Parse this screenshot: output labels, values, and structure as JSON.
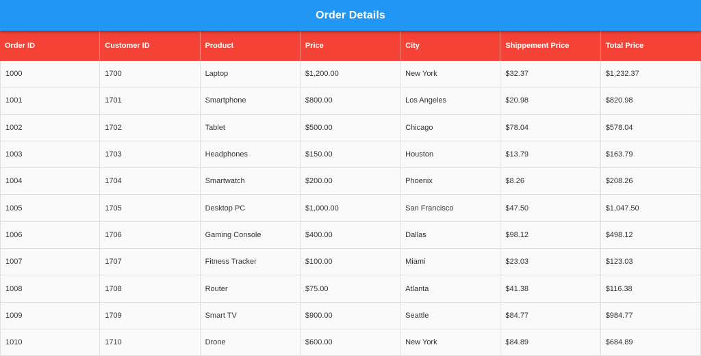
{
  "appbar": {
    "title": "Order Details"
  },
  "colors": {
    "appbar": "#2196f3",
    "header": "#f44336"
  },
  "table": {
    "columns": [
      "Order ID",
      "Customer ID",
      "Product",
      "Price",
      "City",
      "Shippement Price",
      "Total Price"
    ],
    "rows": [
      [
        "1000",
        "1700",
        "Laptop",
        "$1,200.00",
        "New York",
        "$32.37",
        "$1,232.37"
      ],
      [
        "1001",
        "1701",
        "Smartphone",
        "$800.00",
        "Los Angeles",
        "$20.98",
        "$820.98"
      ],
      [
        "1002",
        "1702",
        "Tablet",
        "$500.00",
        "Chicago",
        "$78.04",
        "$578.04"
      ],
      [
        "1003",
        "1703",
        "Headphones",
        "$150.00",
        "Houston",
        "$13.79",
        "$163.79"
      ],
      [
        "1004",
        "1704",
        "Smartwatch",
        "$200.00",
        "Phoenix",
        "$8.26",
        "$208.26"
      ],
      [
        "1005",
        "1705",
        "Desktop PC",
        "$1,000.00",
        "San Francisco",
        "$47.50",
        "$1,047.50"
      ],
      [
        "1006",
        "1706",
        "Gaming Console",
        "$400.00",
        "Dallas",
        "$98.12",
        "$498.12"
      ],
      [
        "1007",
        "1707",
        "Fitness Tracker",
        "$100.00",
        "Miami",
        "$23.03",
        "$123.03"
      ],
      [
        "1008",
        "1708",
        "Router",
        "$75.00",
        "Atlanta",
        "$41.38",
        "$116.38"
      ],
      [
        "1009",
        "1709",
        "Smart TV",
        "$900.00",
        "Seattle",
        "$84.77",
        "$984.77"
      ],
      [
        "1010",
        "1710",
        "Drone",
        "$600.00",
        "New York",
        "$84.89",
        "$684.89"
      ]
    ]
  }
}
